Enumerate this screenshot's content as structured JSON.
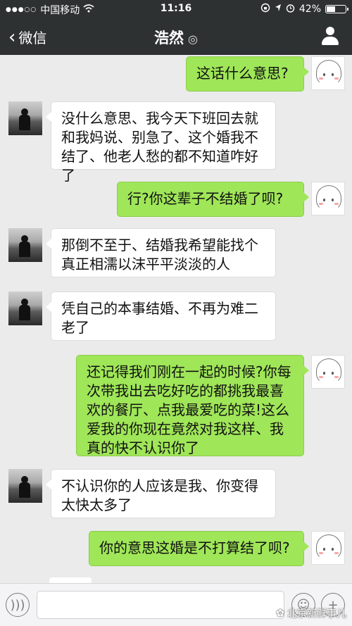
{
  "status_bar": {
    "carrier": "中国移动",
    "time": "11:16",
    "battery": "42%",
    "battery_level": 0.42
  },
  "nav": {
    "back_label": "微信",
    "title": "浩然"
  },
  "messages": [
    {
      "side": "out",
      "text": "这话什么意思?"
    },
    {
      "side": "in",
      "text": "没什么意思、我今天下班回去就和我妈说、别急了、这个婚我不结了、他老人愁的都不知道咋好了"
    },
    {
      "side": "out",
      "text": "行?你这辈子不结婚了呗?"
    },
    {
      "side": "in",
      "text": "那倒不至于、结婚我希望能找个真正相濡以沫平平淡淡的人"
    },
    {
      "side": "in",
      "text": "凭自己的本事结婚、不再为难二老了"
    },
    {
      "side": "out",
      "text": "还记得我们刚在一起的时候?你每次带我出去吃好吃的都挑我最喜欢的餐厅、点我最爱吃的菜!这么爱我的你现在竟然对我这样、我真的快不认识你了"
    },
    {
      "side": "in",
      "text": "不认识你的人应该是我、你变得太快太多了"
    },
    {
      "side": "out",
      "text": "你的意思这婚是不打算结了呗?"
    }
  ],
  "watermark": "北京新鲜事儿",
  "colors": {
    "bar": "#2e3132",
    "background": "#ebebeb",
    "bubble_out": "#9fe658",
    "bubble_in": "#ffffff"
  }
}
